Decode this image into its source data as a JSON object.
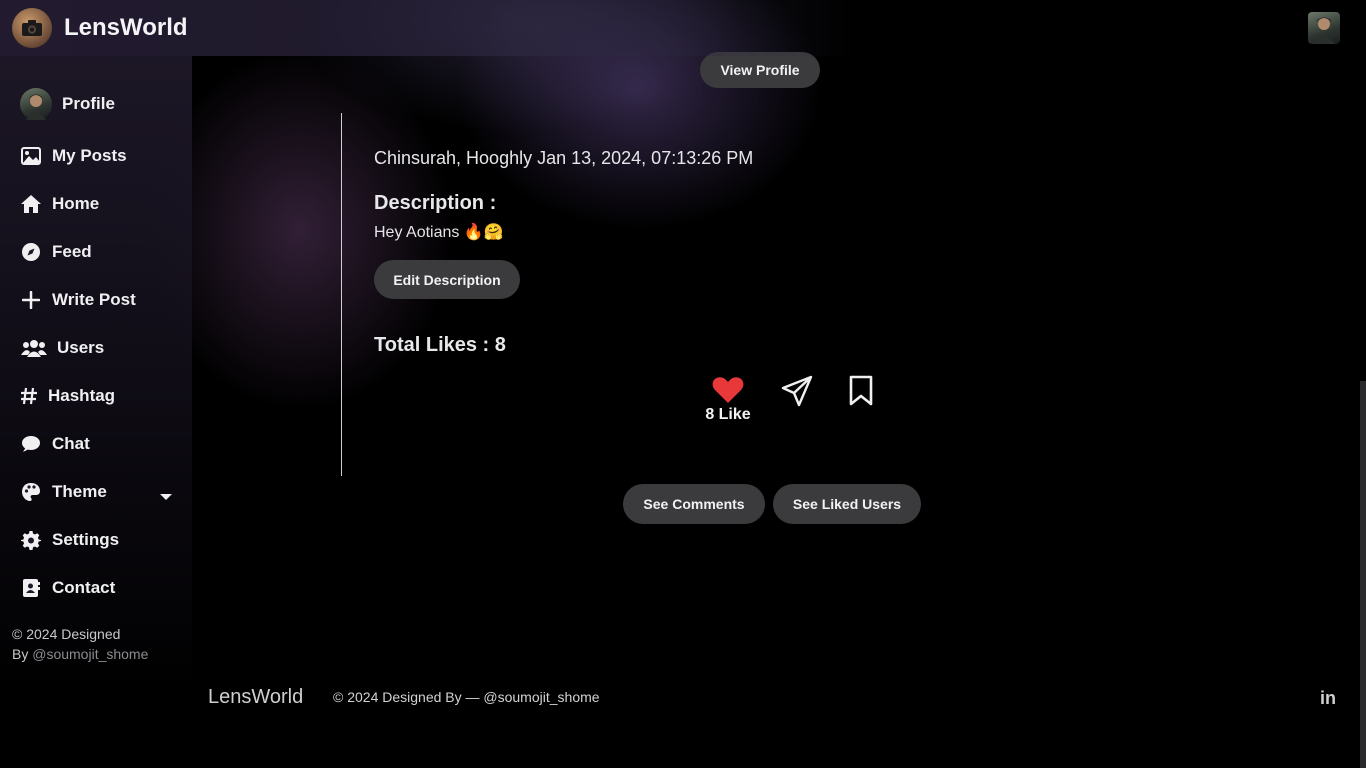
{
  "app": {
    "name": "LensWorld"
  },
  "sidebar": {
    "items": [
      {
        "label": "Profile",
        "icon": "avatar"
      },
      {
        "label": "My Posts",
        "icon": "image-icon"
      },
      {
        "label": "Home",
        "icon": "home-icon"
      },
      {
        "label": "Feed",
        "icon": "compass-icon"
      },
      {
        "label": "Write Post",
        "icon": "plus-icon"
      },
      {
        "label": "Users",
        "icon": "users-icon"
      },
      {
        "label": "Hashtag",
        "icon": "hash-icon"
      },
      {
        "label": "Chat",
        "icon": "chat-icon"
      },
      {
        "label": "Theme",
        "icon": "palette-icon"
      },
      {
        "label": "Settings",
        "icon": "gear-icon"
      },
      {
        "label": "Contact",
        "icon": "contact-icon"
      }
    ],
    "footer_line1": "© 2024 Designed",
    "footer_line2_prefix": "By ",
    "footer_handle": "@soumojit_shome"
  },
  "post": {
    "view_profile_label": "View Profile",
    "location_time": "Chinsurah, Hooghly Jan 13, 2024, 07:13:26 PM",
    "description_title": "Description :",
    "description_text": "Hey Aotians 🔥🤗",
    "edit_description_label": "Edit Description",
    "total_likes_label": "Total Likes : 8",
    "like_count_label": "8 Like",
    "see_comments_label": "See Comments",
    "see_liked_users_label": "See Liked Users"
  },
  "footer": {
    "brand": "LensWorld",
    "copyright": "© 2024 Designed By — @soumojit_shome",
    "linkedin_label": "in"
  },
  "colors": {
    "background": "#000000",
    "pill": "#3b3b3e",
    "heart": "#e8383a"
  }
}
